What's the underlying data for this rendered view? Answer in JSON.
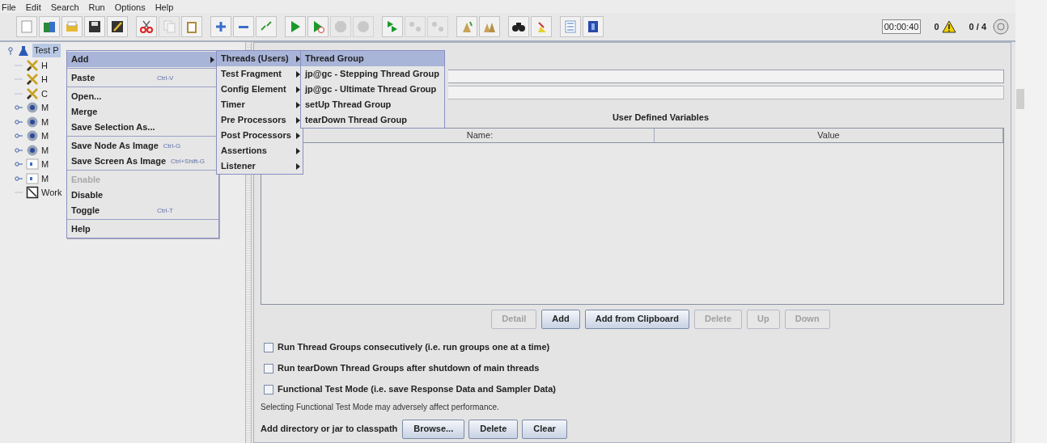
{
  "menubar": [
    {
      "label": "File"
    },
    {
      "label": "Edit"
    },
    {
      "label": "Search"
    },
    {
      "label": "Run"
    },
    {
      "label": "Options"
    },
    {
      "label": "Help"
    }
  ],
  "toolbar": [
    [
      {
        "kind": "new",
        "disabled": false
      },
      {
        "kind": "templates",
        "disabled": false
      },
      {
        "kind": "open",
        "disabled": false
      },
      {
        "kind": "save",
        "disabled": false
      },
      {
        "kind": "saveas",
        "disabled": false
      }
    ],
    [
      {
        "kind": "cut",
        "disabled": false
      },
      {
        "kind": "copy",
        "disabled": true
      },
      {
        "kind": "paste",
        "disabled": false
      }
    ],
    [
      {
        "kind": "expand",
        "disabled": false
      },
      {
        "kind": "collapse",
        "disabled": false
      },
      {
        "kind": "toggle",
        "disabled": false
      }
    ],
    [
      {
        "kind": "start",
        "disabled": false
      },
      {
        "kind": "startnopause",
        "disabled": false
      },
      {
        "kind": "stop",
        "disabled": true
      },
      {
        "kind": "shutdown",
        "disabled": true
      }
    ],
    [
      {
        "kind": "remotestart",
        "disabled": false
      },
      {
        "kind": "remotestop",
        "disabled": true
      },
      {
        "kind": "remoteexit",
        "disabled": true
      }
    ],
    [
      {
        "kind": "clear",
        "disabled": false
      },
      {
        "kind": "clearall",
        "disabled": false
      }
    ],
    [
      {
        "kind": "search",
        "disabled": false
      },
      {
        "kind": "reset",
        "disabled": false
      }
    ],
    [
      {
        "kind": "functions",
        "disabled": false
      },
      {
        "kind": "help",
        "disabled": false
      }
    ]
  ],
  "status": {
    "timer": "00:00:40",
    "warnings": "0",
    "threads": "0 / 4"
  },
  "tree": {
    "label": "Test P",
    "kind": "plan",
    "expanded": true,
    "selected": true,
    "children": [
      {
        "label": "H",
        "kind": "config",
        "expandable": false
      },
      {
        "label": "H",
        "kind": "config",
        "expandable": false
      },
      {
        "label": "C",
        "kind": "config",
        "expandable": false
      },
      {
        "label": "M",
        "kind": "module",
        "expandable": true
      },
      {
        "label": "M",
        "kind": "module",
        "expandable": true
      },
      {
        "label": "M",
        "kind": "module",
        "expandable": true
      },
      {
        "label": "M",
        "kind": "module",
        "expandable": true
      },
      {
        "label": "M",
        "kind": "include",
        "expandable": true
      },
      {
        "label": "M",
        "kind": "include",
        "expandable": true
      },
      {
        "label": "Work",
        "kind": "workbench",
        "expandable": false
      }
    ]
  },
  "context_menu": [
    {
      "kind": "item",
      "label": "Add",
      "submenu": true,
      "selected": true,
      "disabled": false
    },
    {
      "kind": "separator"
    },
    {
      "kind": "item",
      "label": "Paste",
      "shortcut": "Ctrl-V",
      "selected": false,
      "disabled": false
    },
    {
      "kind": "separator"
    },
    {
      "kind": "item",
      "label": "Open...",
      "selected": false,
      "disabled": false
    },
    {
      "kind": "item",
      "label": "Merge",
      "selected": false,
      "disabled": false
    },
    {
      "kind": "item",
      "label": "Save Selection As...",
      "selected": false,
      "disabled": false
    },
    {
      "kind": "separator"
    },
    {
      "kind": "item",
      "label": "Save Node As Image",
      "shortcut": "Ctrl-G",
      "selected": false,
      "disabled": false
    },
    {
      "kind": "item",
      "label": "Save Screen As Image",
      "shortcut": "Ctrl+Shift-G",
      "selected": false,
      "disabled": false
    },
    {
      "kind": "separator"
    },
    {
      "kind": "item",
      "label": "Enable",
      "selected": false,
      "disabled": true
    },
    {
      "kind": "item",
      "label": "Disable",
      "selected": false,
      "disabled": false
    },
    {
      "kind": "item",
      "label": "Toggle",
      "shortcut": "Ctrl-T",
      "selected": false,
      "disabled": false
    },
    {
      "kind": "separator"
    },
    {
      "kind": "item",
      "label": "Help",
      "selected": false,
      "disabled": false
    }
  ],
  "add_submenu": [
    {
      "label": "Threads (Users)",
      "submenu": true,
      "selected": true
    },
    {
      "label": "Test Fragment",
      "submenu": true,
      "selected": false
    },
    {
      "label": "Config Element",
      "submenu": true,
      "selected": false
    },
    {
      "label": "Timer",
      "submenu": true,
      "selected": false
    },
    {
      "label": "Pre Processors",
      "submenu": true,
      "selected": false
    },
    {
      "label": "Post Processors",
      "submenu": true,
      "selected": false
    },
    {
      "label": "Assertions",
      "submenu": true,
      "selected": false
    },
    {
      "label": "Listener",
      "submenu": true,
      "selected": false
    }
  ],
  "threads_submenu": [
    {
      "label": "Thread Group",
      "selected": true
    },
    {
      "label": "jp@gc - Stepping Thread Group",
      "selected": false
    },
    {
      "label": "jp@gc - Ultimate Thread Group",
      "selected": false
    },
    {
      "label": "setUp Thread Group",
      "selected": false
    },
    {
      "label": "tearDown Thread Group",
      "selected": false
    }
  ],
  "variables": {
    "title": "User Defined Variables",
    "columns": [
      "Name:",
      "Value"
    ]
  },
  "table_buttons": [
    {
      "label": "Detail",
      "disabled": true
    },
    {
      "label": "Add",
      "disabled": false
    },
    {
      "label": "Add from Clipboard",
      "disabled": false
    },
    {
      "label": "Delete",
      "disabled": true
    },
    {
      "label": "Up",
      "disabled": true
    },
    {
      "label": "Down",
      "disabled": true
    }
  ],
  "options": [
    {
      "label": "Run Thread Groups consecutively (i.e. run groups one at a time)",
      "checked": false
    },
    {
      "label": "Run tearDown Thread Groups after shutdown of main threads",
      "checked": false
    },
    {
      "label": "Functional Test Mode (i.e. save Response Data and Sampler Data)",
      "checked": false
    }
  ],
  "note": "Selecting Functional Test Mode may adversely affect performance.",
  "classpath": {
    "label": "Add directory or jar to classpath",
    "buttons": [
      {
        "label": "Browse...",
        "disabled": false
      },
      {
        "label": "Delete",
        "disabled": false
      },
      {
        "label": "Clear",
        "disabled": false
      }
    ]
  }
}
